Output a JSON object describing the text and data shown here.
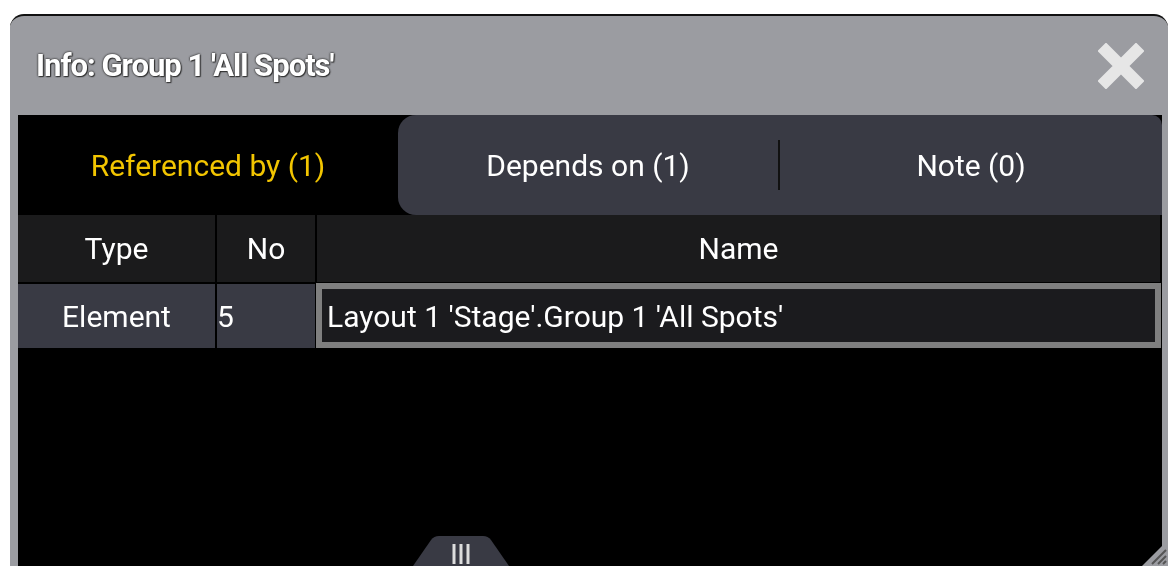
{
  "window": {
    "title": "Info: Group 1 'All Spots'"
  },
  "tabs": [
    {
      "label": "Referenced by (1)",
      "selected": true
    },
    {
      "label": "Depends on (1)",
      "selected": false
    },
    {
      "label": "Note (0)",
      "selected": false
    }
  ],
  "table": {
    "columns": [
      "Type",
      "No",
      "Name"
    ],
    "rows": [
      {
        "cells": [
          "Element",
          "5",
          "Layout 1 'Stage'.Group 1 'All Spots'"
        ],
        "selected": true
      }
    ]
  }
}
